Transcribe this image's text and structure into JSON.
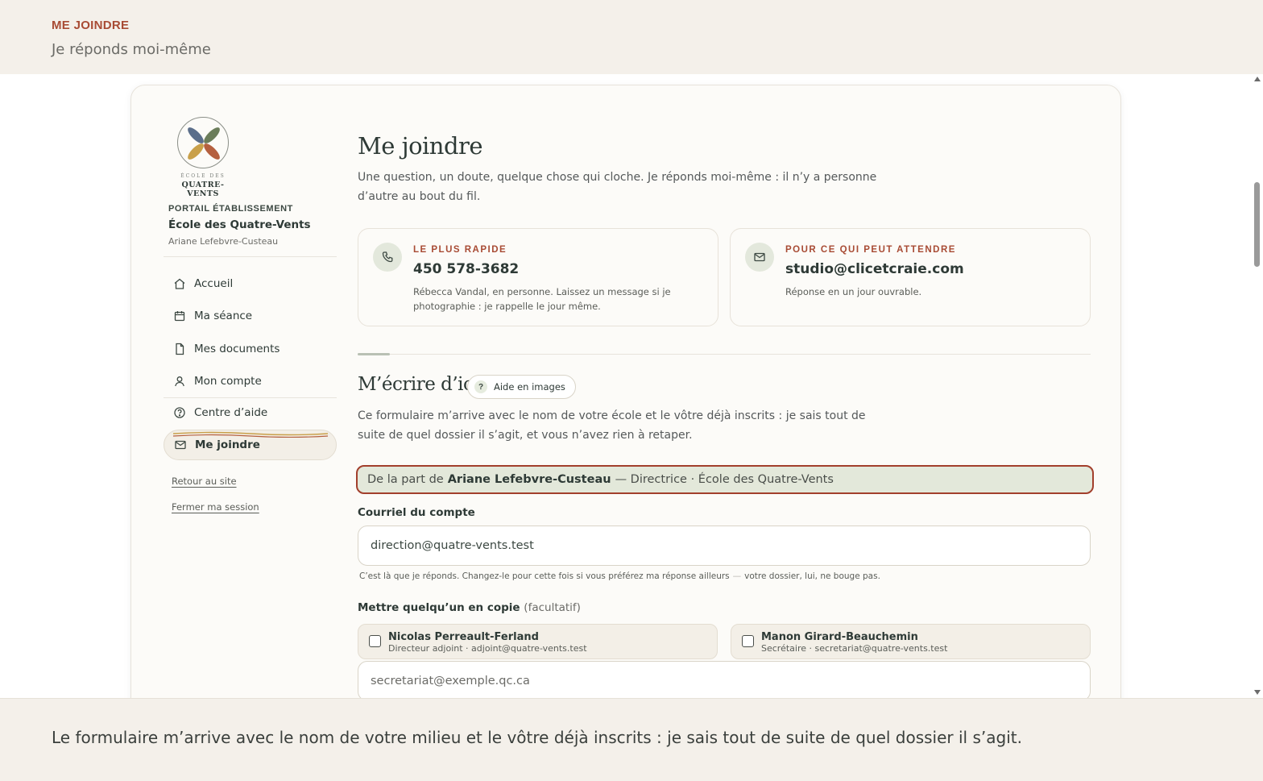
{
  "banner": {
    "eyebrow": "ME JOINDRE",
    "subtitle": "Je réponds moi-même"
  },
  "sidebar": {
    "logo_small": "ÉCOLE DES",
    "logo_name": "QUATRE-VENTS",
    "portal_label": "PORTAIL ÉTABLISSEMENT",
    "school": "École des Quatre-Vents",
    "user": "Ariane Lefebvre-Custeau",
    "nav": [
      {
        "label": "Accueil",
        "icon": "home-icon"
      },
      {
        "label": "Ma séance",
        "icon": "calendar-icon"
      },
      {
        "label": "Mes documents",
        "icon": "document-icon"
      },
      {
        "label": "Mon compte",
        "icon": "user-icon"
      },
      {
        "label": "Centre d’aide",
        "icon": "help-circle-icon"
      },
      {
        "label": "Me joindre",
        "icon": "mail-icon",
        "active": true
      }
    ],
    "links": [
      "Retour au site",
      "Fermer ma session"
    ]
  },
  "main": {
    "title": "Me joindre",
    "intro": "Une question, un doute, quelque chose qui cloche. Je réponds moi-même : il n’y a personne d’autre au bout du fil.",
    "contacts": [
      {
        "icon": "phone-icon",
        "eyebrow": "LE PLUS RAPIDE",
        "value": "450 578-3682",
        "note": "Rébecca Vandal, en personne. Laissez un message si je photographie : je rappelle le jour même."
      },
      {
        "icon": "mail-icon",
        "eyebrow": "POUR CE QUI PEUT ATTENDRE",
        "value": "studio@clicetcraie.com",
        "note": "Réponse en un jour ouvrable."
      }
    ],
    "form_title": "M’écrire d’ici",
    "help_chip": {
      "q": "?",
      "label": "Aide en images"
    },
    "form_desc": "Ce formulaire m’arrive avec le nom de votre école et le vôtre déjà inscrits : je sais tout de suite de quel dossier il s’agit, et vous n’avez rien à retaper.",
    "from": {
      "prefix": "De la part de",
      "name": "Ariane Lefebvre-Custeau",
      "suffix": "— Directrice · École des Quatre-Vents"
    },
    "email_label": "Courriel du compte",
    "email_value": "direction@quatre-vents.test",
    "email_hint_main": "C’est là que je réponds. Changez-le pour cette fois si vous préférez ma réponse ailleurs",
    "email_hint_dash": "—",
    "email_hint_tail": "votre dossier, lui, ne bouge pas.",
    "cc_label": "Mettre quelqu’un en copie",
    "cc_optional": "(facultatif)",
    "cc_people": [
      {
        "name": "Nicolas Perreault-Ferland",
        "role": "Directeur adjoint · adjoint@quatre-vents.test",
        "checked": false
      },
      {
        "name": "Manon Girard-Beauchemin",
        "role": "Secrétaire · secretariat@quatre-vents.test",
        "checked": false
      }
    ],
    "cc_placeholder": "secretariat@exemple.qc.ca"
  },
  "caption": "Le formulaire m’arrive avec le nom de votre milieu et le vôtre déjà inscrits : je sais tout de suite de quel dossier il s’agit.",
  "colors": {
    "accent": "#a84b34",
    "ink": "#2e3a36",
    "sage": "#e3e8da",
    "highlight_border": "#a23f2c"
  }
}
